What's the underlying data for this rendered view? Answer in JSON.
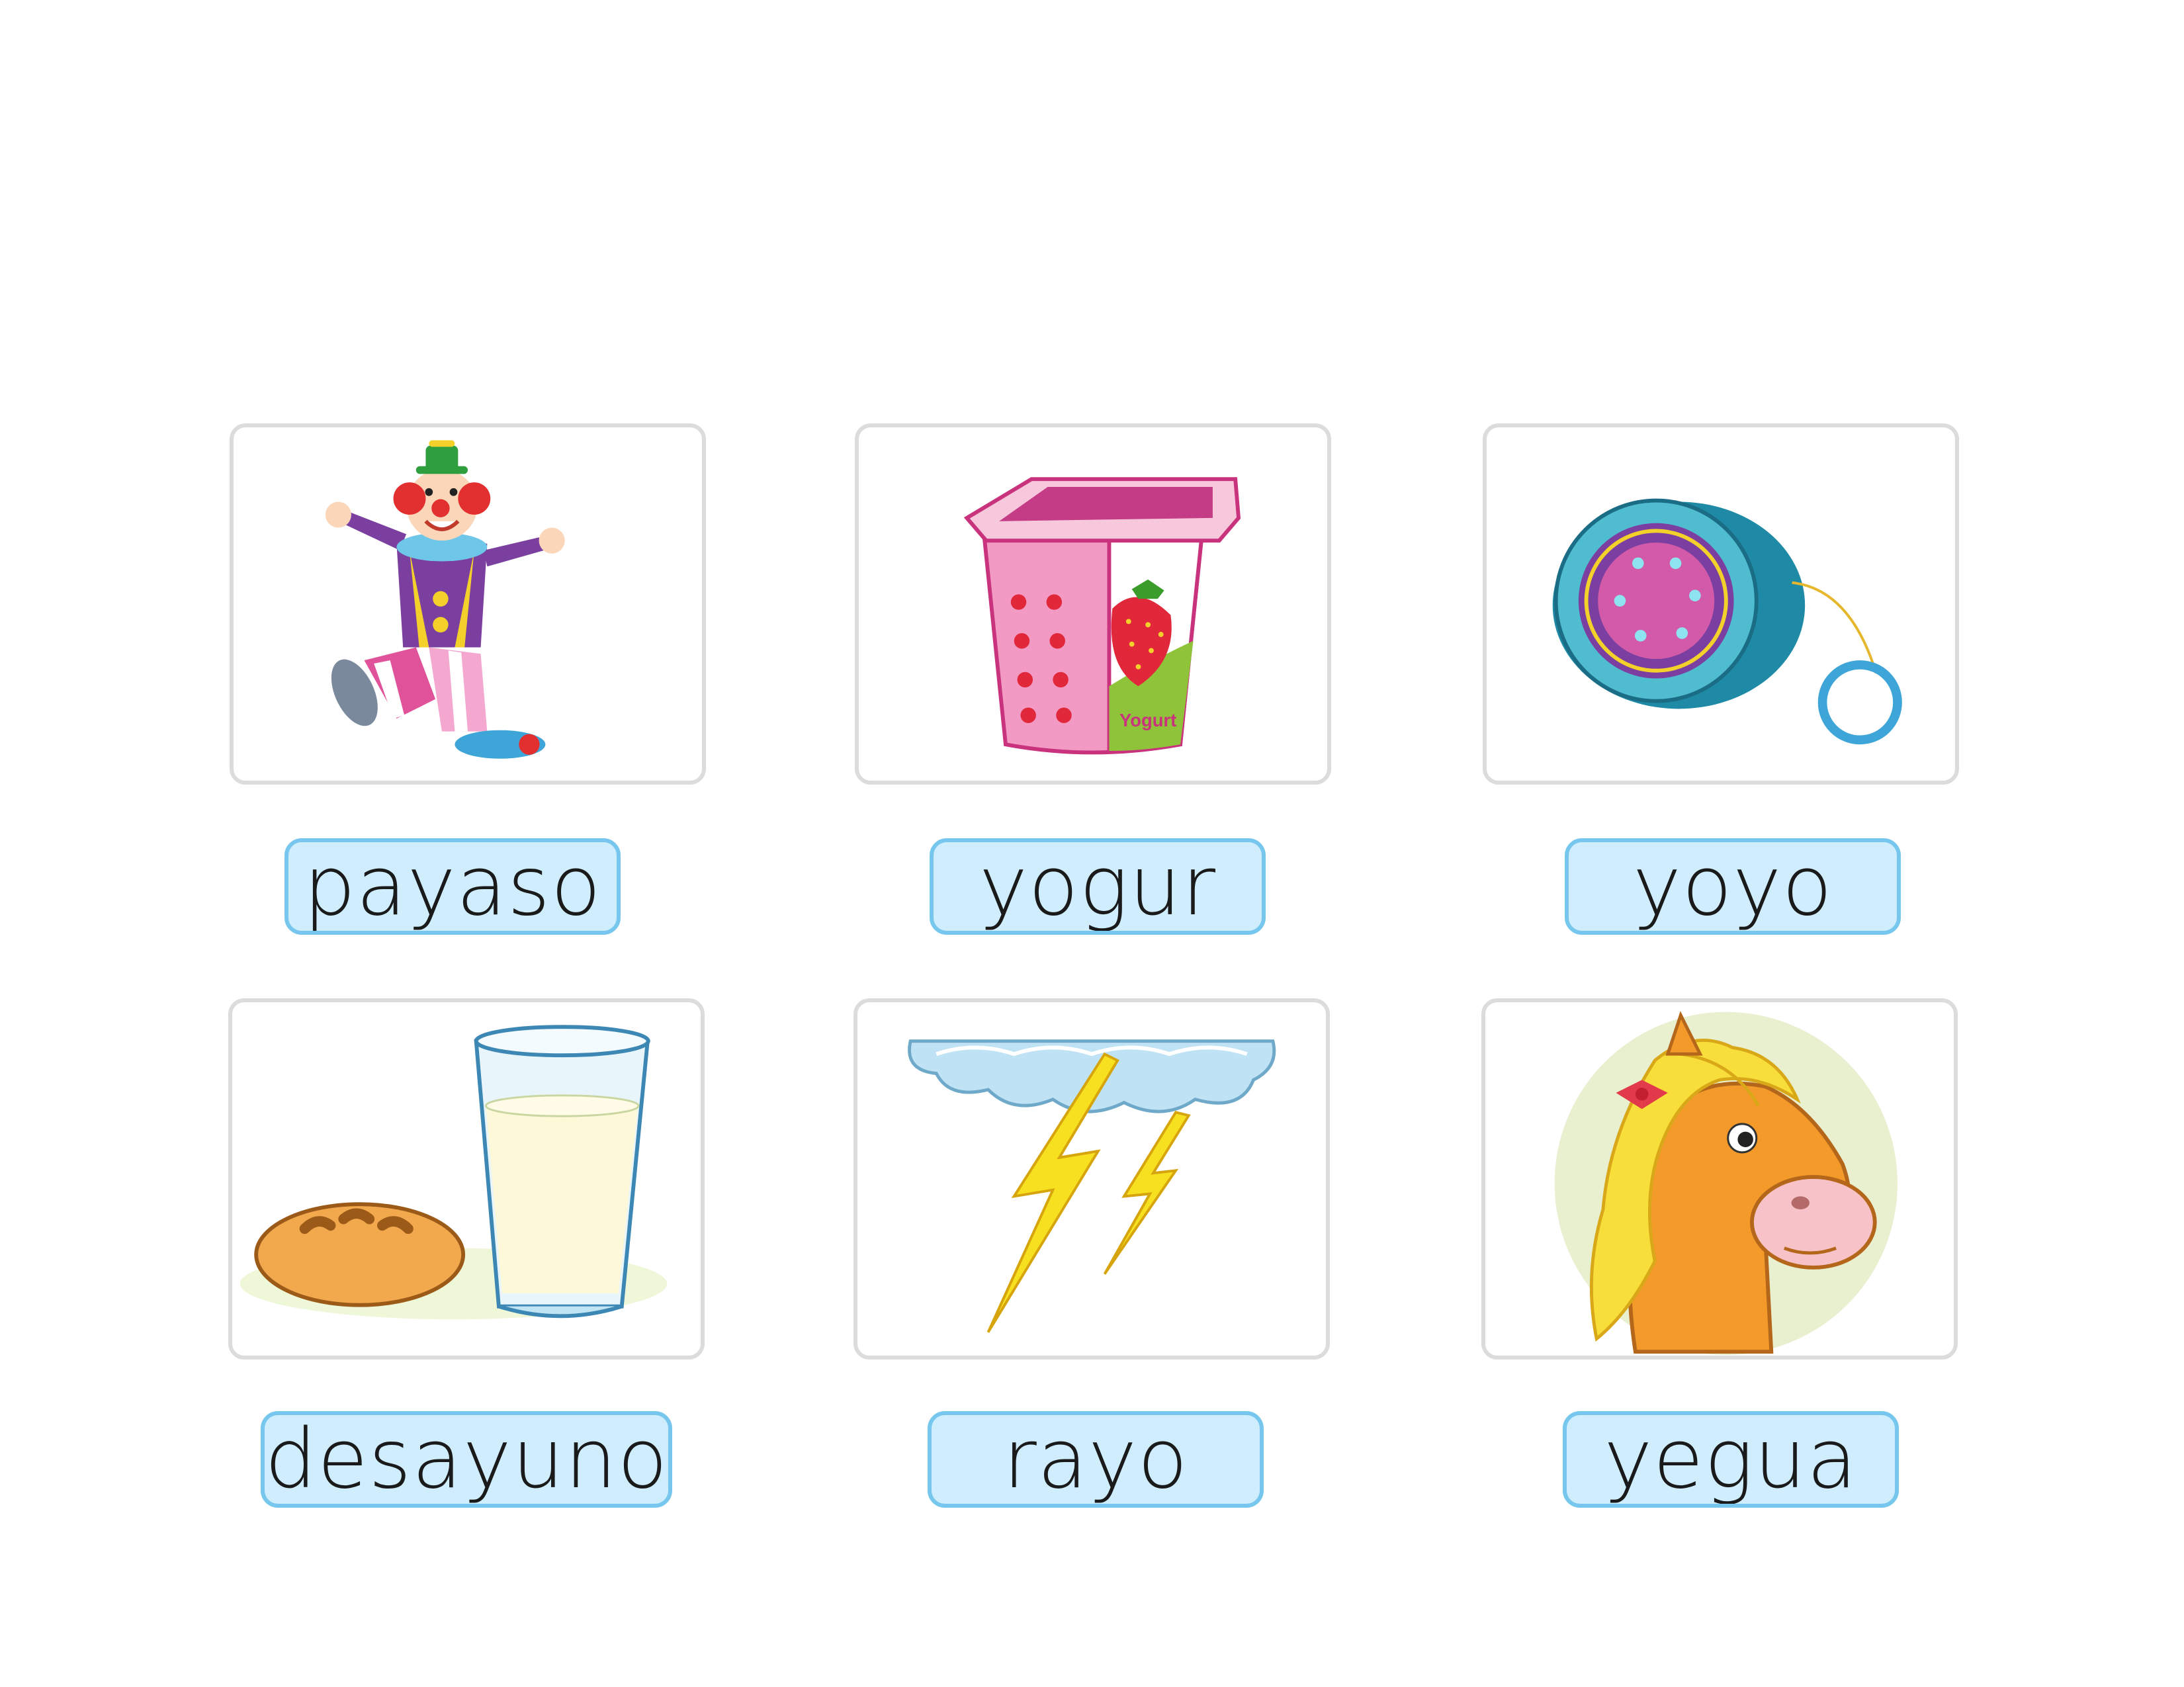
{
  "cards": [
    {
      "word": "payaso",
      "image": "clown-illustration"
    },
    {
      "word": "yogur",
      "image": "strawberry-yogurt-illustration",
      "image_text": "Yogurt"
    },
    {
      "word": "yoyo",
      "image": "yoyo-illustration"
    },
    {
      "word": "desayuno",
      "image": "bread-and-milk-illustration"
    },
    {
      "word": "rayo",
      "image": "lightning-cloud-illustration"
    },
    {
      "word": "yegua",
      "image": "mare-illustration"
    }
  ],
  "colors": {
    "card_border": "#dcdcdc",
    "label_fill": "#cfedfd",
    "label_border": "#76c6ee",
    "text": "#1a1a1a"
  }
}
